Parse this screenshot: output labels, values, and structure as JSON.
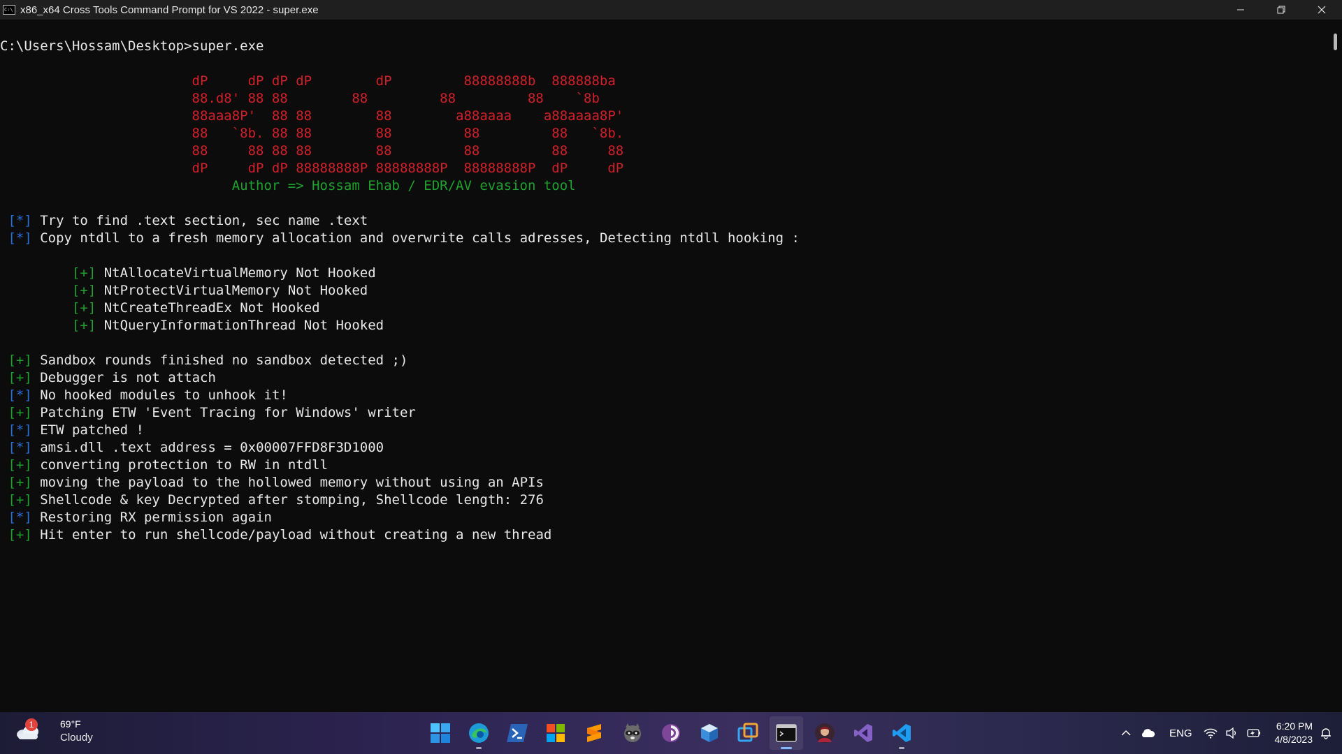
{
  "window": {
    "title": "x86_x64 Cross Tools Command Prompt for VS 2022 - super.exe",
    "icon_text": "C:\\"
  },
  "console": {
    "prompt_line": "C:\\Users\\Hossam\\Desktop>super.exe",
    "ascii_art": [
      "                        dP     dP dP dP        dP         88888888b  888888ba",
      "                        88.d8' 88 88        88         88         88    `8b",
      "                        88aaa8P'  88 88        88        a88aaaa    a88aaaa8P'",
      "                        88   `8b. 88 88        88         88         88   `8b.",
      "                        88     88 88 88        88         88         88     88",
      "                        dP     dP dP 88888888P 88888888P  88888888P  dP     dP"
    ],
    "author_line": "                             Author => Hossam Ehab / EDR/AV evasion tool",
    "messages_1": [
      {
        "bracket": "[*]",
        "kind": "star",
        "text": "Try to find .text section, sec name .text"
      },
      {
        "bracket": "[*]",
        "kind": "star",
        "text": "Copy ntdll to a fresh memory allocation and overwrite calls adresses, Detecting ntdll hooking :"
      }
    ],
    "hook_checks": [
      {
        "bracket": "[+]",
        "text": "NtAllocateVirtualMemory Not Hooked"
      },
      {
        "bracket": "[+]",
        "text": "NtProtectVirtualMemory Not Hooked"
      },
      {
        "bracket": "[+]",
        "text": "NtCreateThreadEx Not Hooked"
      },
      {
        "bracket": "[+]",
        "text": "NtQueryInformationThread Not Hooked"
      }
    ],
    "messages_2": [
      {
        "bracket": "[+]",
        "kind": "plus",
        "text": "Sandbox rounds finished no sandbox detected ;)"
      },
      {
        "bracket": "[+]",
        "kind": "plus",
        "text": "Debugger is not attach"
      },
      {
        "bracket": "[*]",
        "kind": "star",
        "text": "No hooked modules to unhook it!"
      },
      {
        "bracket": "[+]",
        "kind": "plus",
        "text": "Patching ETW 'Event Tracing for Windows' writer"
      },
      {
        "bracket": "[*]",
        "kind": "star",
        "text": "ETW patched !"
      },
      {
        "bracket": "[*]",
        "kind": "star",
        "text": "amsi.dll .text address = 0x00007FFD8F3D1000"
      },
      {
        "bracket": "[+]",
        "kind": "plus",
        "text": "converting protection to RW in ntdll"
      },
      {
        "bracket": "[+]",
        "kind": "plus",
        "text": "moving the payload to the hollowed memory without using an APIs"
      },
      {
        "bracket": "[+]",
        "kind": "plus",
        "text": "Shellcode & key Decrypted after stomping, Shellcode length: 276"
      },
      {
        "bracket": "[*]",
        "kind": "star",
        "text": "Restoring RX permission again"
      },
      {
        "bracket": "[+]",
        "kind": "plus",
        "text": "Hit enter to run shellcode/payload without creating a new thread"
      }
    ]
  },
  "colors": {
    "star_bracket": "#2a6fd6",
    "plus_bracket": "#1fa12e",
    "ascii_red": "#d0202a",
    "author_green": "#1fa12e"
  },
  "taskbar": {
    "weather": {
      "badge": "1",
      "temp": "69°F",
      "condition": "Cloudy"
    },
    "apps": [
      {
        "name": "start",
        "icon": "windows-logo-icon"
      },
      {
        "name": "edge",
        "icon": "edge-icon"
      },
      {
        "name": "powershell",
        "icon": "powershell-icon"
      },
      {
        "name": "store",
        "icon": "store-icon"
      },
      {
        "name": "sublime-text",
        "icon": "sublime-icon"
      },
      {
        "name": "raccoon-app",
        "icon": "raccoon-icon"
      },
      {
        "name": "tor-browser",
        "icon": "tor-icon"
      },
      {
        "name": "box-app",
        "icon": "cube-icon"
      },
      {
        "name": "remote-desktop",
        "icon": "remote-desktop-icon"
      },
      {
        "name": "terminal",
        "icon": "terminal-icon"
      },
      {
        "name": "avatar-app",
        "icon": "avatar-icon"
      },
      {
        "name": "visual-studio",
        "icon": "visual-studio-icon"
      },
      {
        "name": "vscode",
        "icon": "vscode-icon"
      }
    ],
    "tray": {
      "language": "ENG",
      "time": "6:20 PM",
      "date": "4/8/2023"
    }
  }
}
